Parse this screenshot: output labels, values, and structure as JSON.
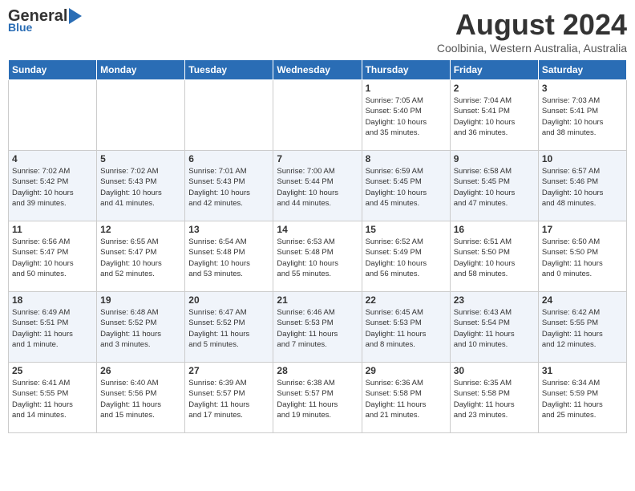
{
  "header": {
    "logo_general": "General",
    "logo_blue": "Blue",
    "month_title": "August 2024",
    "location": "Coolbinia, Western Australia, Australia"
  },
  "days_of_week": [
    "Sunday",
    "Monday",
    "Tuesday",
    "Wednesday",
    "Thursday",
    "Friday",
    "Saturday"
  ],
  "weeks": [
    [
      {
        "day": "",
        "info": ""
      },
      {
        "day": "",
        "info": ""
      },
      {
        "day": "",
        "info": ""
      },
      {
        "day": "",
        "info": ""
      },
      {
        "day": "1",
        "info": "Sunrise: 7:05 AM\nSunset: 5:40 PM\nDaylight: 10 hours\nand 35 minutes."
      },
      {
        "day": "2",
        "info": "Sunrise: 7:04 AM\nSunset: 5:41 PM\nDaylight: 10 hours\nand 36 minutes."
      },
      {
        "day": "3",
        "info": "Sunrise: 7:03 AM\nSunset: 5:41 PM\nDaylight: 10 hours\nand 38 minutes."
      }
    ],
    [
      {
        "day": "4",
        "info": "Sunrise: 7:02 AM\nSunset: 5:42 PM\nDaylight: 10 hours\nand 39 minutes."
      },
      {
        "day": "5",
        "info": "Sunrise: 7:02 AM\nSunset: 5:43 PM\nDaylight: 10 hours\nand 41 minutes."
      },
      {
        "day": "6",
        "info": "Sunrise: 7:01 AM\nSunset: 5:43 PM\nDaylight: 10 hours\nand 42 minutes."
      },
      {
        "day": "7",
        "info": "Sunrise: 7:00 AM\nSunset: 5:44 PM\nDaylight: 10 hours\nand 44 minutes."
      },
      {
        "day": "8",
        "info": "Sunrise: 6:59 AM\nSunset: 5:45 PM\nDaylight: 10 hours\nand 45 minutes."
      },
      {
        "day": "9",
        "info": "Sunrise: 6:58 AM\nSunset: 5:45 PM\nDaylight: 10 hours\nand 47 minutes."
      },
      {
        "day": "10",
        "info": "Sunrise: 6:57 AM\nSunset: 5:46 PM\nDaylight: 10 hours\nand 48 minutes."
      }
    ],
    [
      {
        "day": "11",
        "info": "Sunrise: 6:56 AM\nSunset: 5:47 PM\nDaylight: 10 hours\nand 50 minutes."
      },
      {
        "day": "12",
        "info": "Sunrise: 6:55 AM\nSunset: 5:47 PM\nDaylight: 10 hours\nand 52 minutes."
      },
      {
        "day": "13",
        "info": "Sunrise: 6:54 AM\nSunset: 5:48 PM\nDaylight: 10 hours\nand 53 minutes."
      },
      {
        "day": "14",
        "info": "Sunrise: 6:53 AM\nSunset: 5:48 PM\nDaylight: 10 hours\nand 55 minutes."
      },
      {
        "day": "15",
        "info": "Sunrise: 6:52 AM\nSunset: 5:49 PM\nDaylight: 10 hours\nand 56 minutes."
      },
      {
        "day": "16",
        "info": "Sunrise: 6:51 AM\nSunset: 5:50 PM\nDaylight: 10 hours\nand 58 minutes."
      },
      {
        "day": "17",
        "info": "Sunrise: 6:50 AM\nSunset: 5:50 PM\nDaylight: 11 hours\nand 0 minutes."
      }
    ],
    [
      {
        "day": "18",
        "info": "Sunrise: 6:49 AM\nSunset: 5:51 PM\nDaylight: 11 hours\nand 1 minute."
      },
      {
        "day": "19",
        "info": "Sunrise: 6:48 AM\nSunset: 5:52 PM\nDaylight: 11 hours\nand 3 minutes."
      },
      {
        "day": "20",
        "info": "Sunrise: 6:47 AM\nSunset: 5:52 PM\nDaylight: 11 hours\nand 5 minutes."
      },
      {
        "day": "21",
        "info": "Sunrise: 6:46 AM\nSunset: 5:53 PM\nDaylight: 11 hours\nand 7 minutes."
      },
      {
        "day": "22",
        "info": "Sunrise: 6:45 AM\nSunset: 5:53 PM\nDaylight: 11 hours\nand 8 minutes."
      },
      {
        "day": "23",
        "info": "Sunrise: 6:43 AM\nSunset: 5:54 PM\nDaylight: 11 hours\nand 10 minutes."
      },
      {
        "day": "24",
        "info": "Sunrise: 6:42 AM\nSunset: 5:55 PM\nDaylight: 11 hours\nand 12 minutes."
      }
    ],
    [
      {
        "day": "25",
        "info": "Sunrise: 6:41 AM\nSunset: 5:55 PM\nDaylight: 11 hours\nand 14 minutes."
      },
      {
        "day": "26",
        "info": "Sunrise: 6:40 AM\nSunset: 5:56 PM\nDaylight: 11 hours\nand 15 minutes."
      },
      {
        "day": "27",
        "info": "Sunrise: 6:39 AM\nSunset: 5:57 PM\nDaylight: 11 hours\nand 17 minutes."
      },
      {
        "day": "28",
        "info": "Sunrise: 6:38 AM\nSunset: 5:57 PM\nDaylight: 11 hours\nand 19 minutes."
      },
      {
        "day": "29",
        "info": "Sunrise: 6:36 AM\nSunset: 5:58 PM\nDaylight: 11 hours\nand 21 minutes."
      },
      {
        "day": "30",
        "info": "Sunrise: 6:35 AM\nSunset: 5:58 PM\nDaylight: 11 hours\nand 23 minutes."
      },
      {
        "day": "31",
        "info": "Sunrise: 6:34 AM\nSunset: 5:59 PM\nDaylight: 11 hours\nand 25 minutes."
      }
    ]
  ]
}
